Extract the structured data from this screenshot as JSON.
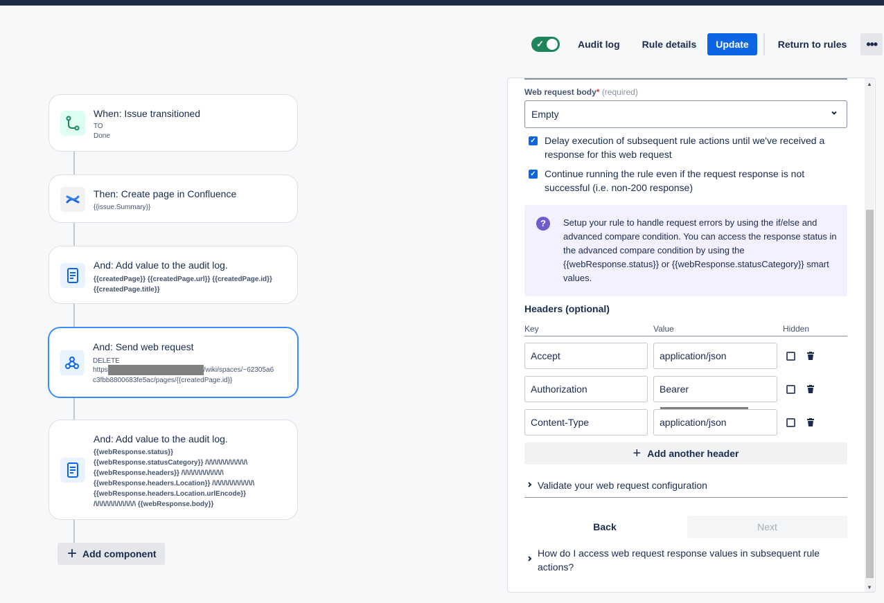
{
  "toolbar": {
    "toggle_enabled": true,
    "audit_log": "Audit log",
    "rule_details": "Rule details",
    "update": "Update",
    "return_to_rules": "Return to rules",
    "more": "•••"
  },
  "flow": {
    "trigger": {
      "title": "When: Issue transitioned",
      "line1": "TO",
      "line2": "Done"
    },
    "confluence": {
      "title": "Then: Create page in Confluence",
      "sub": "{{issue.Summary}}"
    },
    "audit1": {
      "title": "And: Add value to the audit log.",
      "line1": "{{createdPage}} {{createdPage.url}} {{createdPage.id}}",
      "line2": "{{createdPage.title}}"
    },
    "webreq": {
      "title": "And: Send web request",
      "method": "DELETE",
      "url_prefix": "https",
      "url_suffix": "/wiki/spaces/~62305a6",
      "url_line2": "c3fbb8800683fe5ac/pages/{{createdPage.id}}"
    },
    "audit2": {
      "title": "And: Add value to the audit log.",
      "lines": [
        "{{webResponse.status}}",
        "{{webResponse.statusCategory}} /\\/\\/\\/\\/\\/\\/\\/\\/\\/\\/\\",
        "{{webResponse.headers}} /\\/\\/\\/\\/\\/\\/\\/\\/\\/\\/\\",
        "{{webResponse.headers.Location}} /\\/\\/\\/\\/\\/\\/\\/\\/\\/\\/\\",
        "{{webResponse.headers.Location.urlEncode}}",
        "/\\/\\/\\/\\/\\/\\/\\/\\/\\/\\/\\ {{webResponse.body}}"
      ]
    },
    "add_component": "Add component"
  },
  "panel": {
    "body_label": "Web request body",
    "required_mark": "*",
    "required_text": "(required)",
    "body_value": "Empty",
    "delay_checkbox": "Delay execution of subsequent rule actions until we've received a response for this web request",
    "continue_checkbox": "Continue running the rule even if the request response is not successful (i.e. non-200 response)",
    "info_text": "Setup your rule to handle request errors by using the if/else and advanced compare condition. You can access the response status in the advanced compare condition by using the {{webResponse.status}} or {{webResponse.statusCategory}} smart values.",
    "headers_title": "Headers (optional)",
    "col_key": "Key",
    "col_value": "Value",
    "col_hidden": "Hidden",
    "headers": [
      {
        "key": "Accept",
        "value": "application/json"
      },
      {
        "key": "Authorization",
        "value": "Bearer"
      },
      {
        "key": "Content-Type",
        "value": "application/json"
      }
    ],
    "add_header": "Add another header",
    "validate": "Validate your web request configuration",
    "back": "Back",
    "next": "Next",
    "faq": "How do I access web request response values in subsequent rule actions?"
  },
  "colors": {
    "primary": "#0c66e4",
    "toggle_on": "#1f845a",
    "selected_border": "#388bff",
    "info_bg": "#f3f0ff"
  },
  "icons": [
    "check-icon",
    "branch-icon",
    "confluence-icon",
    "document-icon",
    "webhook-icon",
    "plus-icon",
    "chevron-down-icon",
    "chevron-right-icon",
    "question-icon",
    "trash-icon",
    "more-icon"
  ]
}
